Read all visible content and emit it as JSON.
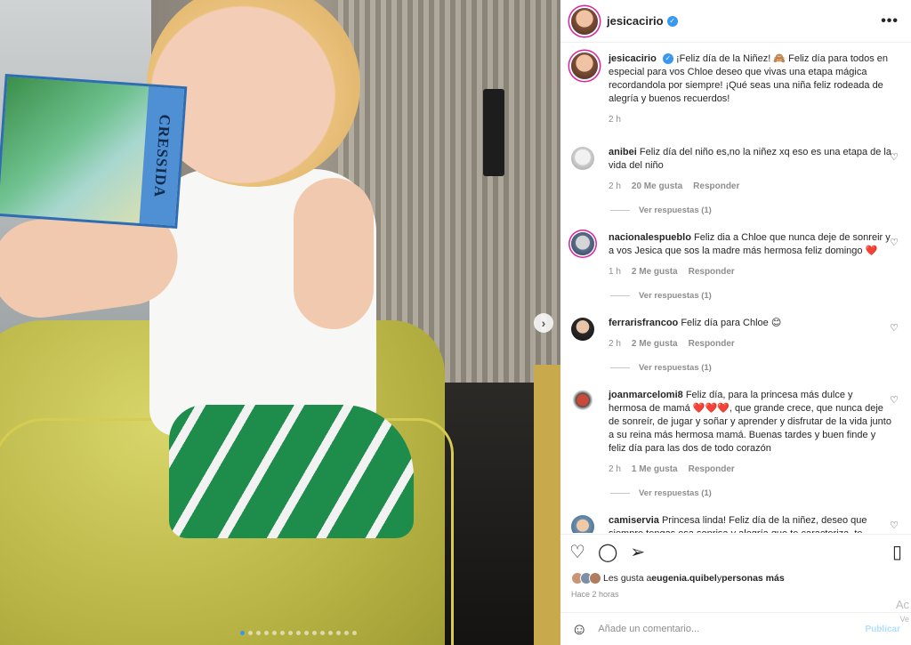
{
  "post": {
    "username": "jesicacirio",
    "book_title": "CRESSIDA",
    "carousel_next": "›"
  },
  "caption": {
    "username": "jesicacirio",
    "text": "¡Feliz día de la Niñez! 🙈 Feliz día para todos en especial para vos Chloe deseo que vivas una etapa mágica recordandola por siempre! ¡Qué seas una niña feliz rodeada de alegría y buenos recuerdos!",
    "time": "2 h"
  },
  "comments": [
    {
      "username": "anibei",
      "text": "Feliz día del niño es,no la niñez xq eso es una etapa de la vida del niño",
      "time": "2 h",
      "likes": "20 Me gusta",
      "reply": "Responder",
      "replies": "Ver respuestas (1)"
    },
    {
      "username": "nacionalespueblo",
      "text": "Feliz dia a Chloe que nunca deje de sonreir y a vos Jesica que sos la madre más hermosa feliz domingo ❤️",
      "time": "1 h",
      "likes": "2 Me gusta",
      "reply": "Responder",
      "replies": "Ver respuestas (1)"
    },
    {
      "username": "ferrarisfrancoo",
      "text": "Feliz día para Chloe 😊",
      "time": "2 h",
      "likes": "2 Me gusta",
      "reply": "Responder",
      "replies": "Ver respuestas (1)"
    },
    {
      "username": "joanmarcelomi8",
      "text": "Feliz día, para la princesa más dulce y hermosa de mamá ❤️❤️❤️, que grande crece, que nunca deje de sonreír, de jugar y soñar y aprender y disfrutar de la vida junto a su reina más hermosa mamá. Buenas tardes y buen finde y feliz día para las dos de todo corazón",
      "time": "2 h",
      "likes": "1 Me gusta",
      "reply": "Responder",
      "replies": "Ver respuestas (1)"
    },
    {
      "username": "camiservia",
      "text": "Princesa linda! Feliz día de la niñez, deseo que siempre tengas esa sonrisa y alegría que te caracteriza, te ...",
      "time": "",
      "likes": "",
      "reply": "",
      "replies": ""
    }
  ],
  "likes": {
    "prefix": "Les gusta a ",
    "user": "eugenia.quibel",
    "middle": " y ",
    "others": "personas más"
  },
  "time_ago": "Hace 2 horas",
  "add_comment": {
    "placeholder": "Añade un comentario...",
    "publish": "Publicar"
  },
  "watermark": {
    "line1": "Ac",
    "line2": "Ve"
  },
  "icons": {
    "heart": "heart-icon",
    "comment": "comment-icon",
    "share": "share-icon",
    "save": "bookmark-icon",
    "emoji": "emoji-icon",
    "more": "more-options-icon"
  },
  "colors": {
    "verified": "#3897f0",
    "muted": "#8e8e8e",
    "publish": "#b2dffc"
  }
}
